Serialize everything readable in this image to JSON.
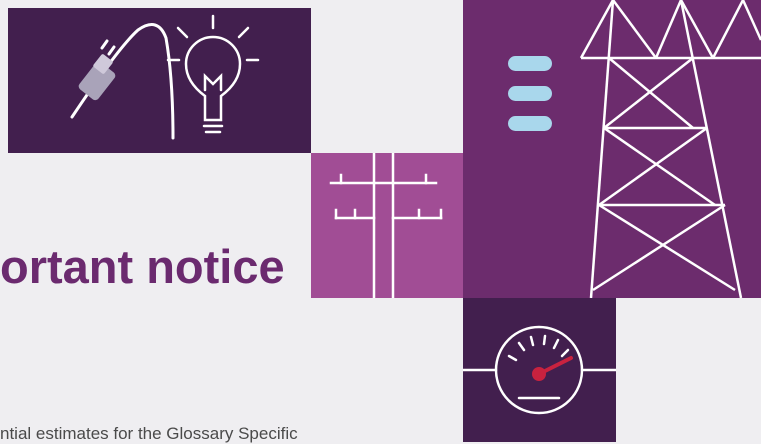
{
  "slide": {
    "heading": "ortant notice",
    "body_fragment": "ntial estimates for the Glossary Specific"
  },
  "colors": {
    "background": "#efeef1",
    "dark_purple": "#421f4e",
    "medium_purple": "#6c2c6d",
    "pink_purple": "#a14d95",
    "heading": "#6b2a6f",
    "accent_blue": "#a9d7ec",
    "accent_red": "#c8223f",
    "line": "#ffffff"
  },
  "icons": [
    "plug-icon",
    "light-bulb-icon",
    "utility-pole-icon",
    "transmission-tower-icon",
    "battery-icon",
    "gauge-icon"
  ]
}
